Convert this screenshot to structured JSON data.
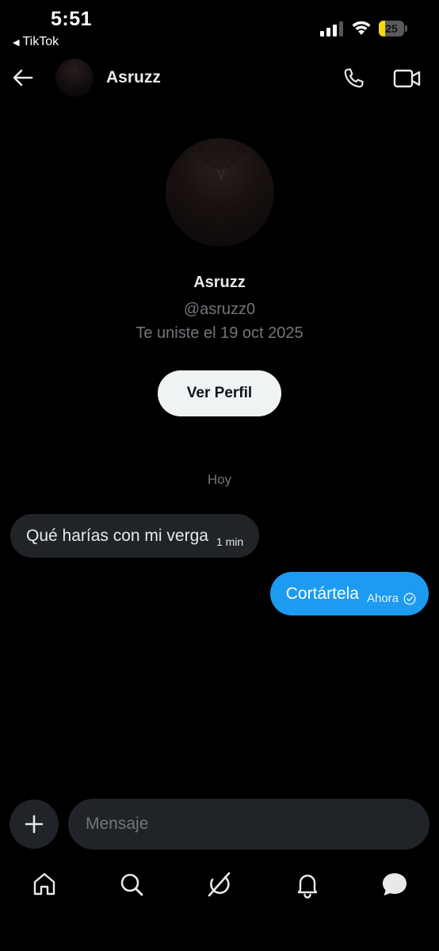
{
  "status_bar": {
    "time": "5:51",
    "back_app": "TikTok",
    "battery_level": "25",
    "battery_color": "#f5d90a"
  },
  "header": {
    "name": "Asruzz"
  },
  "profile": {
    "name": "Asruzz",
    "handle": "@asruzz0",
    "joined": "Te uniste el 19 oct 2025",
    "view_profile_label": "Ver Perfil"
  },
  "chat": {
    "date_separator": "Hoy",
    "messages": [
      {
        "direction": "incoming",
        "text": "Qué harías con mi verga",
        "time": "1 min"
      },
      {
        "direction": "outgoing",
        "text": "Cortártela",
        "time": "Ahora",
        "status_icon": "check-circle-icon"
      }
    ]
  },
  "composer": {
    "placeholder": "Mensaje"
  },
  "bottom_nav": {
    "tabs": [
      {
        "icon": "home-icon"
      },
      {
        "icon": "search-icon"
      },
      {
        "icon": "grok-icon"
      },
      {
        "icon": "bell-icon"
      },
      {
        "icon": "messages-icon",
        "active": true
      }
    ]
  },
  "colors": {
    "background": "#000000",
    "accent": "#1d9bf0",
    "incoming_bubble": "#202327",
    "muted_text": "#71767b"
  }
}
